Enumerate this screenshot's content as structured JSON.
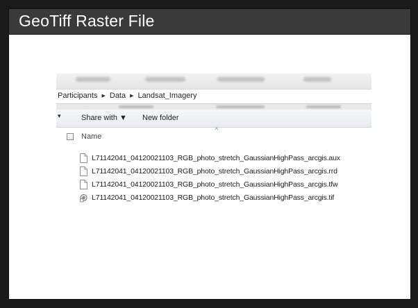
{
  "slide": {
    "title": "GeoTiff Raster File"
  },
  "explorer": {
    "breadcrumb": [
      "Participants",
      "Data",
      "Landsat_Imagery"
    ],
    "breadcrumb_separator": "▶",
    "toolbar": {
      "share_with_label": "Share with ▼",
      "new_folder_label": "New folder"
    },
    "column_header": {
      "name_label": "Name"
    },
    "files": [
      {
        "name": "L71142041_04120021103_RGB_photo_stretch_GaussianHighPass_arcgis.aux",
        "icon": "blank-file-icon"
      },
      {
        "name": "L71142041_04120021103_RGB_photo_stretch_GaussianHighPass_arcgis.rrd",
        "icon": "blank-file-icon"
      },
      {
        "name": "L71142041_04120021103_RGB_photo_stretch_GaussianHighPass_arcgis.tfw",
        "icon": "blank-file-icon"
      },
      {
        "name": "L71142041_04120021103_RGB_photo_stretch_GaussianHighPass_arcgis.tif",
        "icon": "image-file-icon"
      }
    ]
  }
}
